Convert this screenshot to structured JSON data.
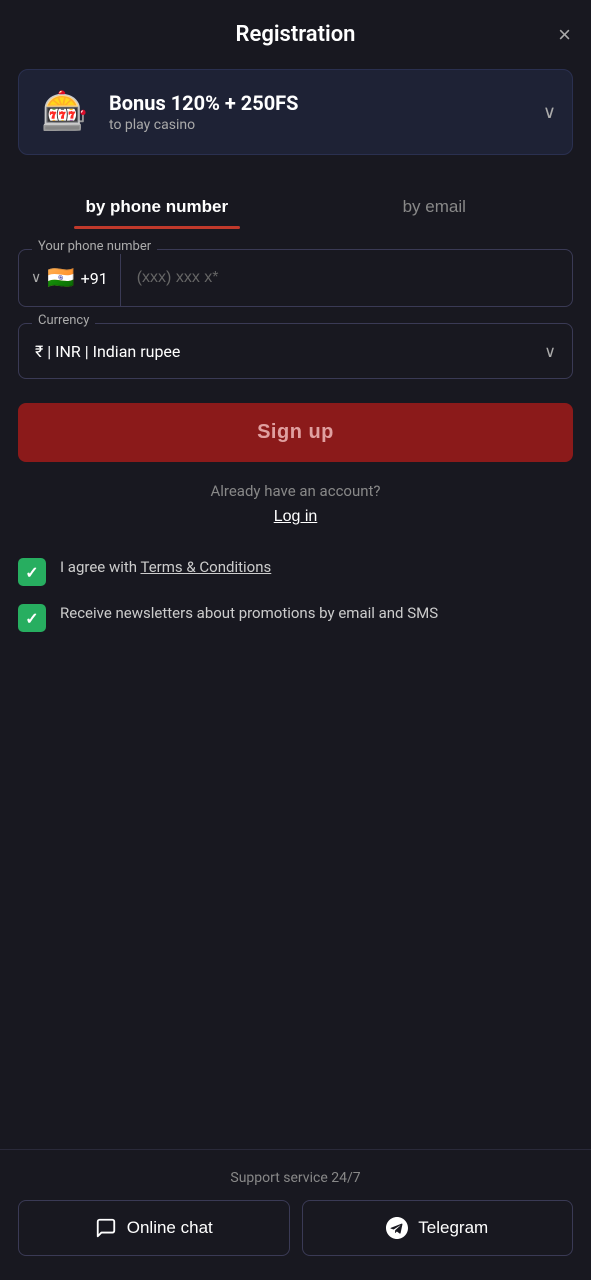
{
  "header": {
    "title": "Registration",
    "close_label": "×"
  },
  "bonus": {
    "icon": "🎰",
    "title": "Bonus 120% + 250FS",
    "subtitle": "to play casino",
    "chevron": "∨"
  },
  "tabs": [
    {
      "id": "phone",
      "label": "by phone number",
      "active": true
    },
    {
      "id": "email",
      "label": "by email",
      "active": false
    }
  ],
  "form": {
    "phone": {
      "label": "Your phone number",
      "country_flag": "🇮🇳",
      "country_code": "+91",
      "placeholder": "(xxx) xxx x*"
    },
    "currency": {
      "label": "Currency",
      "value": "₹ | INR | Indian rupee"
    },
    "signup_button": "Sign up",
    "already_account": "Already have an account?",
    "login_link": "Log in"
  },
  "checkboxes": [
    {
      "id": "terms",
      "checked": true,
      "text_before": "I agree with ",
      "link_text": "Terms & Conditions",
      "text_after": ""
    },
    {
      "id": "newsletter",
      "checked": true,
      "text": "Receive newsletters about promotions by email and SMS"
    }
  ],
  "footer": {
    "support_label": "Support service 24/7",
    "buttons": [
      {
        "id": "chat",
        "label": "Online chat",
        "icon": "chat"
      },
      {
        "id": "telegram",
        "label": "Telegram",
        "icon": "telegram"
      }
    ]
  }
}
